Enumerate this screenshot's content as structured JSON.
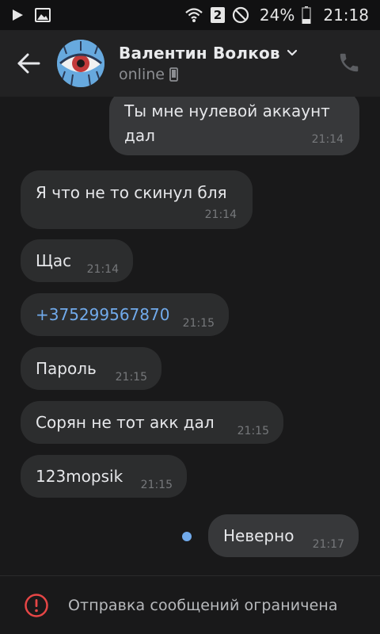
{
  "status_bar": {
    "sim": "2",
    "battery": "24%",
    "time": "21:18"
  },
  "header": {
    "name": "Валентин Волков",
    "status": "online"
  },
  "messages": [
    {
      "dir": "out",
      "text_line1": "Ты мне нулевой аккаунт",
      "text_line2": "дал",
      "time": "21:14"
    },
    {
      "dir": "in",
      "text": "Я что не то скинул бля",
      "time": "21:14"
    },
    {
      "dir": "in",
      "text": "Щас",
      "time": "21:14"
    },
    {
      "dir": "in",
      "text": "+375299567870",
      "time": "21:15",
      "is_link": true
    },
    {
      "dir": "in",
      "text": "Пароль",
      "time": "21:15"
    },
    {
      "dir": "in",
      "text": "Сорян не тот акк дал",
      "time": "21:15"
    },
    {
      "dir": "in",
      "text": "123mopsik",
      "time": "21:15"
    },
    {
      "dir": "out",
      "text": "Неверно",
      "time": "21:17",
      "unread": true
    }
  ],
  "footer": {
    "text": "Отправка сообщений ограничена"
  },
  "colors": {
    "background": "#19191a",
    "bubble_in": "#2c2d2e",
    "bubble_out": "#37383a",
    "accent": "#71aaeb",
    "warning": "#e64646"
  }
}
